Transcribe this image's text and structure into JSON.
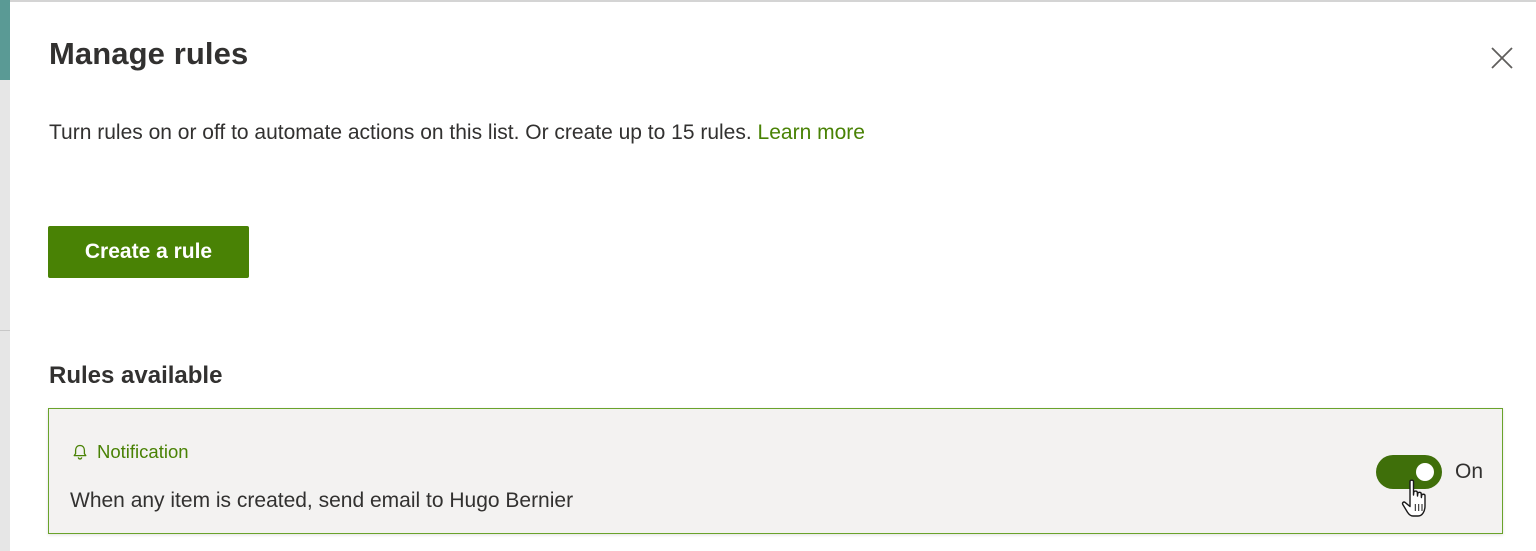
{
  "panel": {
    "title": "Manage rules",
    "close_icon": "close-icon"
  },
  "intro": {
    "description": "Turn rules on or off to automate actions on this list. Or create up to 15 rules.",
    "learn_more": "Learn more"
  },
  "actions": {
    "create_rule_label": "Create a rule"
  },
  "rules_section": {
    "heading": "Rules available",
    "rules": [
      {
        "type_icon": "bell-icon",
        "type_label": "Notification",
        "description": "When any item is created, send email to Hugo Bernier",
        "enabled": true,
        "toggle_label": "On"
      }
    ]
  },
  "colors": {
    "accent": "#498205",
    "toggle_on": "#3f6f0a",
    "card_border": "#6aa32b",
    "card_background": "#f3f2f1",
    "text": "#323130"
  }
}
